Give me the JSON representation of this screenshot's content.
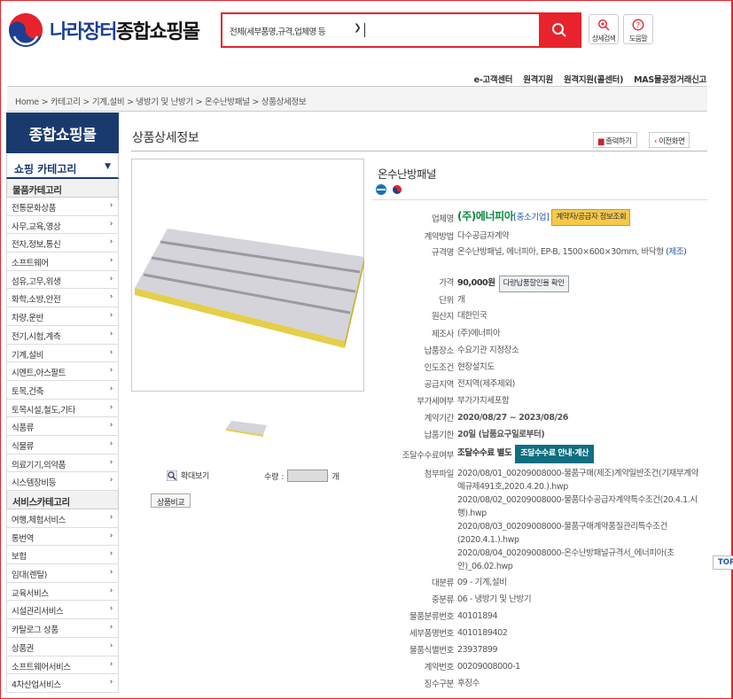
{
  "header": {
    "brand_prefix": "나라장터",
    "brand_suffix": "종합쇼핑몰",
    "search_select": "전체(세부품명,규격,업체명 등",
    "search_value": "",
    "icons": [
      {
        "label": "상세검색",
        "icon": "magnifier-plus-icon"
      },
      {
        "label": "도움말",
        "icon": "question-icon"
      }
    ],
    "accent_color": "#e8232b",
    "nav": [
      "e-고객센터",
      "원격지원",
      "원격지원(콜센터)",
      "MAS물공정거래신고"
    ]
  },
  "breadcrumb": "Home > 카테고리 > 기계,설비 > 냉방기 및 난방기 > 온수난방패널 > 상품상세정보",
  "sidebar": {
    "title": "종합쇼핑몰",
    "category_label": "쇼핑 카테고리",
    "goods_header": "물품카테고리",
    "goods": [
      "전통문화상품",
      "사무,교육,영상",
      "전자,정보,통신",
      "소프트웨어",
      "섬유,고무,위생",
      "화학,소방,안전",
      "차량,운반",
      "전기,시험,계측",
      "기계,설비",
      "시멘트,아스팔트",
      "토목,건축",
      "토목시설,철도,기타",
      "식품류",
      "식물류",
      "의료기기,의약품",
      "시스템장비등"
    ],
    "service_header": "서비스카테고리",
    "services": [
      "여행,체험서비스",
      "통번역",
      "보험",
      "임대(렌탈)",
      "교육서비스",
      "시설관리서비스",
      "카탈로그 상품",
      "상품권",
      "소프트웨어서비스",
      "4차산업서비스"
    ]
  },
  "main": {
    "page_title": "상품상세정보",
    "print_label": "출력하기",
    "back_label": "이전화면",
    "zoom_label": "확대보기",
    "qty_label": "수량 :",
    "qty_unit": "개",
    "qty_value": "",
    "compare_label": "상품비교"
  },
  "product": {
    "name": "온수난방패널",
    "rows": {
      "vendor": {
        "label": "업체명",
        "name": "(주)에너피아",
        "tag": "중소기업",
        "button": "계약자/공급자 정보조회"
      },
      "method": {
        "label": "계약방법",
        "value": "다수공급자계약"
      },
      "spec": {
        "label": "규격명",
        "value": "온수난방패널, 에너피아, EP-B, 1500×600×30mm, 바닥형",
        "link": "(제조)"
      },
      "price": {
        "label": "가격",
        "value": "90,000원",
        "button": "다량납품할인율 확인"
      },
      "unit": {
        "label": "단위",
        "value": "개"
      },
      "origin": {
        "label": "원산지",
        "value": "대한민국"
      },
      "maker": {
        "label": "제조사",
        "value": "(주)에너피아"
      },
      "delivery_place": {
        "label": "납품장소",
        "value": "수요기관 지정장소"
      },
      "terms": {
        "label": "인도조건",
        "value": "현장설치도"
      },
      "supply_area": {
        "label": "공급지역",
        "value": "전지역(제주제외)"
      },
      "vat": {
        "label": "부가세여부",
        "value": "부가가치세포함"
      },
      "period": {
        "label": "계약기간",
        "value": "2020/08/27 ~ 2023/08/26"
      },
      "delivery_term": {
        "label": "납품기한",
        "value": "20일 (납품요구일로부터)"
      },
      "fee": {
        "label": "조달수수료여부",
        "value": "조달수수료 별도",
        "button": "조달수수료 안내·계산"
      },
      "attach": {
        "label": "첨부파일",
        "files": [
          "2020/08/01_00209008000-물품구매(제조)계약일반조건(기재부계약예규제491호,2020.4.20.).hwp",
          "2020/08/02_00209008000-물품다수공급자계약특수조건(20.4.1.시행).hwp",
          "2020/08/03_00209008000-물품구매계약품질관리특수조건(2020.4.1.).hwp",
          "2020/08/04_00209008000-온수난방패널규격서_에너피아(초안)_06.02.hwp"
        ]
      },
      "large": {
        "label": "대분류",
        "value": "09 - 기계,설비"
      },
      "middle": {
        "label": "중분류",
        "value": "06 - 냉방기 및 난방기"
      },
      "class_no": {
        "label": "물품분류번호",
        "value": "40101894"
      },
      "detail_no": {
        "label": "세부품명번호",
        "value": "4010189402"
      },
      "id_no": {
        "label": "물품식별번호",
        "value": "23937899"
      },
      "contract_no": {
        "label": "계약번호",
        "value": "00209008000-1"
      },
      "collect": {
        "label": "징수구분",
        "value": "후징수"
      }
    }
  },
  "top_label": "TOP"
}
